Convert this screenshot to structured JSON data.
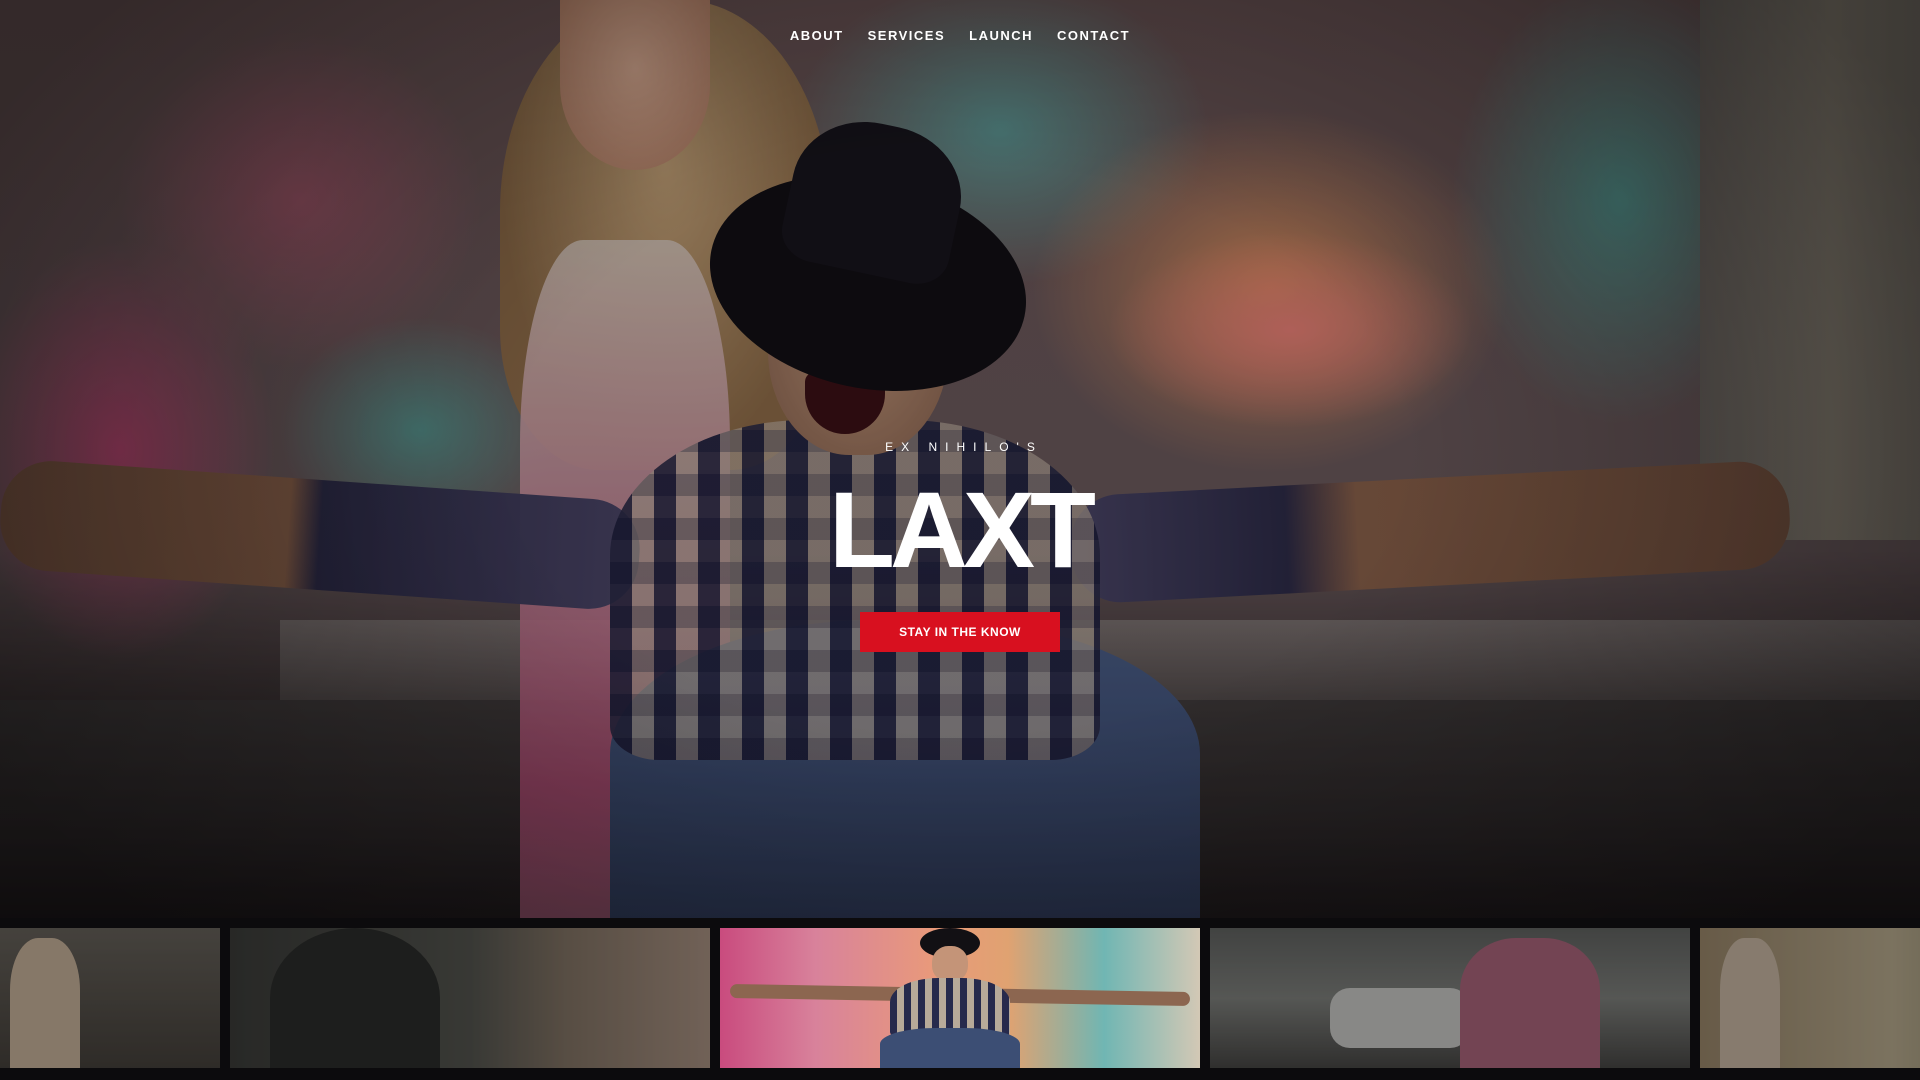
{
  "nav": {
    "items": [
      {
        "label": "ABOUT"
      },
      {
        "label": "SERVICES"
      },
      {
        "label": "LAUNCH"
      },
      {
        "label": "CONTACT"
      }
    ]
  },
  "hero": {
    "eyebrow": "EX NIHILO'S",
    "title": "LAXT",
    "cta_label": "STAY IN THE KNOW"
  },
  "thumbnails": {
    "count": 5,
    "active_index": 2
  },
  "colors": {
    "accent": "#d8101f",
    "text": "#ffffff",
    "strip_background": "#0c0b0d"
  }
}
